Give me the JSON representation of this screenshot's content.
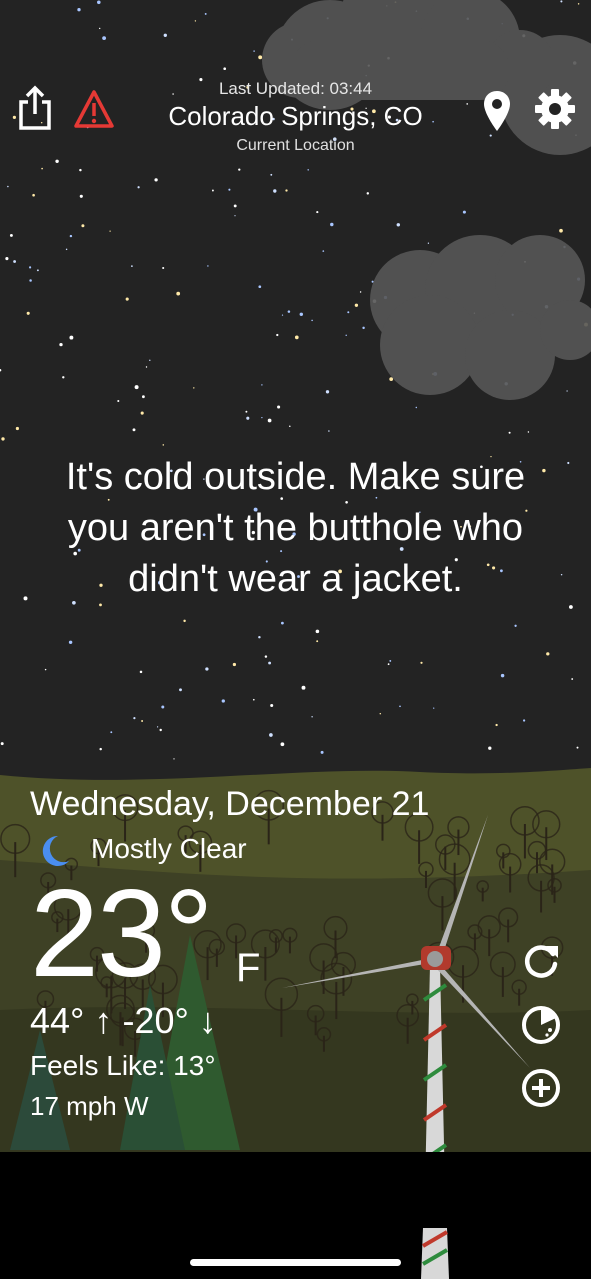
{
  "header": {
    "last_updated": "Last Updated: 03:44",
    "location_name": "Colorado Springs, CO",
    "location_subtitle": "Current Location"
  },
  "message": "It's cold outside. Make sure you aren't the butthole who didn't wear a jacket.",
  "current": {
    "date": "Wednesday, December 21",
    "condition": "Mostly Clear",
    "condition_icon": "moon-icon",
    "temperature": "23°",
    "unit": "F",
    "hi_lo": "44° ↑ -20° ↓",
    "feels_like": "Feels Like: 13°",
    "wind": "17 mph W"
  },
  "icons": {
    "share": "share-icon",
    "alert": "warning-icon",
    "location": "location-pin-icon",
    "settings": "gear-icon",
    "refresh": "refresh-icon",
    "radar": "radar-icon",
    "add": "add-icon"
  },
  "colors": {
    "sky": "#232323",
    "ground": "#3b3a24",
    "alert": "#e53935",
    "moon": "#4a8ef0",
    "cloud": "#5a5a5a"
  }
}
